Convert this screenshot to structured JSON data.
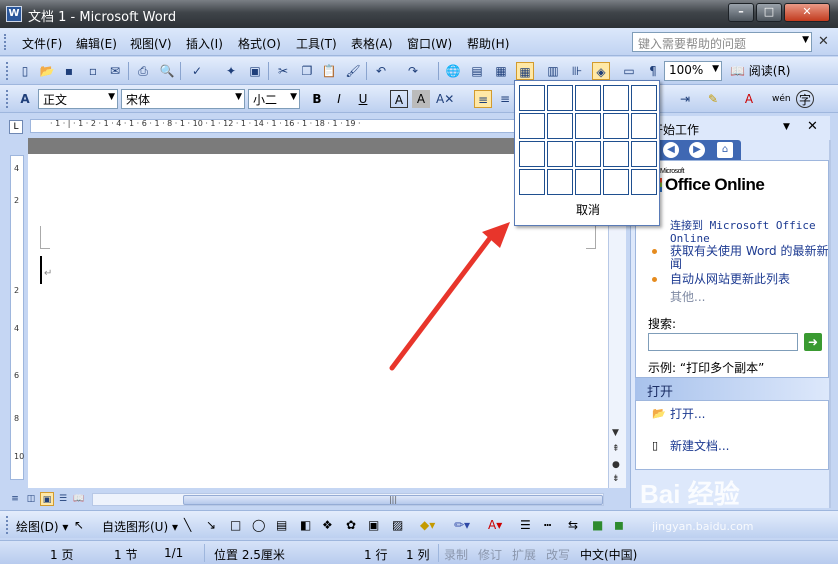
{
  "window": {
    "title": "文档 1 - Microsoft Word",
    "app_icon": "W",
    "min": "–",
    "max": "□",
    "close": "✕"
  },
  "menu": {
    "items": [
      "文件(F)",
      "编辑(E)",
      "视图(V)",
      "插入(I)",
      "格式(O)",
      "工具(T)",
      "表格(A)",
      "窗口(W)",
      "帮助(H)"
    ],
    "help_placeholder": "键入需要帮助的问题"
  },
  "standard_toolbar": {
    "zoom": "100%",
    "read_label": "阅读(R)"
  },
  "formatting_toolbar": {
    "style": "正文",
    "font": "宋体",
    "size": "小二",
    "bold": "B",
    "italic": "I",
    "underline": "U",
    "wen": "wén"
  },
  "table_grid": {
    "rows": 4,
    "cols": 5,
    "cancel_label": "取消"
  },
  "task_pane": {
    "title": "开始工作",
    "logo_text": "Office Online",
    "logo_small": "Microsoft",
    "links": [
      "连接到 Microsoft Office Online",
      "获取有关使用 Word 的最新新闻",
      "自动从网站更新此列表"
    ],
    "more": "其他...",
    "search_label": "搜索:",
    "example": "示例: “打印多个副本”",
    "open_header": "打开",
    "open_link": "打开...",
    "new_doc": "新建文档..."
  },
  "ruler": {
    "ticks": "· 1 · | · 1 · 2 · 1 · 4 · 1 · 6 · 1 · 8 · 1 · 10 · 1 · 12 · 1 · 14 · 1 · 16 · 1 · 18 · 1 · 19 ·",
    "tab": "L"
  },
  "hscroll_label": "|||",
  "draw_toolbar": {
    "draw": "绘图(D) ▾",
    "autoshapes": "自选图形(U) ▾"
  },
  "status": {
    "page": "1 页",
    "section": "1 节",
    "pages": "1/1",
    "position": "位置 2.5厘米",
    "line": "1 行",
    "col": "1 列",
    "rec": "录制",
    "trk": "修订",
    "ext": "扩展",
    "ovr": "改写",
    "lang": "中文(中国)"
  },
  "watermark": {
    "brand": "Bai 经验",
    "url": "jingyan.baidu.com"
  },
  "colors": {
    "accent": "#3f68b3",
    "arrow": "#e8352b"
  }
}
